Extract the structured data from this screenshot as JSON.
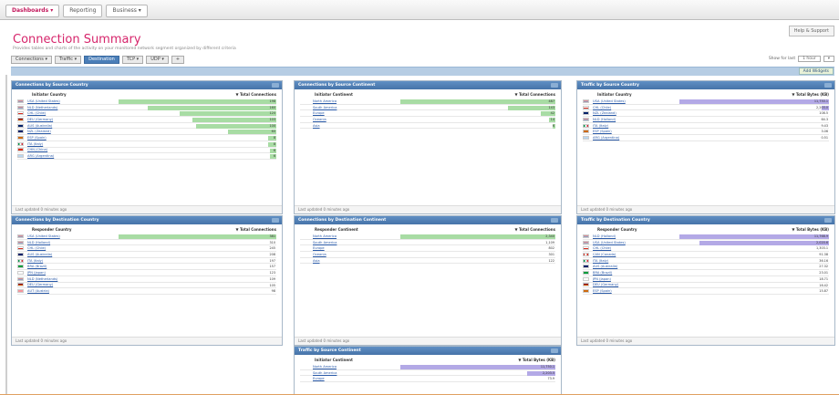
{
  "topnav": {
    "tabs": [
      "Dashboards ▾",
      "Reporting",
      "Business ▾"
    ]
  },
  "header": {
    "title": "Connection Summary",
    "subtitle": "Provides tables and charts of the activity on your monitored network segment organized by different criteria",
    "help_label": "Help & Support"
  },
  "filters": [
    "Connections ▾",
    "Traffic ▾",
    "Destination",
    "TCP ▾",
    "UDP ▾",
    "+"
  ],
  "showfor": {
    "label": "Show for last",
    "value": "1 hour",
    "unit": "▾"
  },
  "add_widget_label": "Add Widgets",
  "colors": {
    "accent": "#d6256b",
    "header_blue": "#4673a8",
    "bar_green": "#a8dca4",
    "bar_purple": "#b3a9e6"
  },
  "widgets": [
    {
      "title": "Connections by Source Country",
      "col_label": "Initiator Country",
      "col_value": "▼ Total Connections",
      "bar": "green",
      "footer": "Last updated 0 minutes ago",
      "rows": [
        {
          "label": "USA (United States)",
          "value": "198",
          "pct": 0.98,
          "flag": "us"
        },
        {
          "label": "NLD (Netherlands)",
          "value": "160",
          "pct": 0.8,
          "flag": "nl"
        },
        {
          "label": "CHL (Chile)",
          "value": "120",
          "pct": 0.6,
          "flag": "cl"
        },
        {
          "label": "DEU (Germany)",
          "value": "103",
          "pct": 0.52,
          "flag": "de"
        },
        {
          "label": "AUS (Australia)",
          "value": "100",
          "pct": 0.5,
          "flag": "au"
        },
        {
          "label": "NZL (Zealand)",
          "value": "60",
          "pct": 0.3,
          "flag": "nz"
        },
        {
          "label": "ESP (Spain)",
          "value": "8",
          "pct": 0.05,
          "flag": "es"
        },
        {
          "label": "ITA (Italy)",
          "value": "8",
          "pct": 0.05,
          "flag": "it"
        },
        {
          "label": "CHN (China)",
          "value": "6",
          "pct": 0.04,
          "flag": "cn"
        },
        {
          "label": "ARG (Argentina)",
          "value": "6",
          "pct": 0.04,
          "flag": "ar"
        }
      ]
    },
    {
      "title": "Connections by Source Continent",
      "col_label": "Initiator Continent",
      "col_value": "▼ Total Connections",
      "bar": "green",
      "footer": "Last updated 0 minutes ago",
      "rows": [
        {
          "label": "North America",
          "value": "487",
          "pct": 0.98
        },
        {
          "label": "South America",
          "value": "143",
          "pct": 0.3
        },
        {
          "label": "Europe",
          "value": "42",
          "pct": 0.09
        },
        {
          "label": "Oceania",
          "value": "14",
          "pct": 0.04
        },
        {
          "label": "Asia",
          "value": "6",
          "pct": 0.02
        }
      ]
    },
    {
      "title": "Traffic by Source Country",
      "col_label": "Initiator Country",
      "col_value": "▼ Total Bytes (KB)",
      "bar": "purple",
      "footer": "Last updated 0 minutes ago",
      "rows": [
        {
          "label": "USA (United States)",
          "value": "11,750.1",
          "pct": 0.98,
          "flag": "us"
        },
        {
          "label": "CHL (Chile)",
          "value": "2,203.0",
          "pct": 0.05,
          "flag": "cl"
        },
        {
          "label": "NZL (Zealand)",
          "value": "108.5",
          "pct": 0.0,
          "flag": "nz"
        },
        {
          "label": "NLD (Holland)",
          "value": "64.3",
          "pct": 0.0,
          "flag": "nl"
        },
        {
          "label": "ITA (Italy)",
          "value": "9.43",
          "pct": 0.0,
          "flag": "it"
        },
        {
          "label": "ESP (Spain)",
          "value": "3.06",
          "pct": 0.0,
          "flag": "es"
        },
        {
          "label": "ARG (Argentina)",
          "value": "0.51",
          "pct": 0.0,
          "flag": "ar"
        }
      ]
    },
    {
      "title": "Connections by Destination Country",
      "col_label": "Responder Country",
      "col_value": "▼ Total Connections",
      "bar": "green",
      "footer": "Last updated 0 minutes ago",
      "rows": [
        {
          "label": "USA (United States)",
          "value": "381",
          "pct": 0.98,
          "flag": "us"
        },
        {
          "label": "NLD (Holland)",
          "value": "310",
          "pct": 0.0,
          "flag": "nl"
        },
        {
          "label": "CHL (Chile)",
          "value": "245",
          "pct": 0.0,
          "flag": "cl"
        },
        {
          "label": "AUS (Australia)",
          "value": "208",
          "pct": 0.0,
          "flag": "au"
        },
        {
          "label": "ITA (Italy)",
          "value": "197",
          "pct": 0.0,
          "flag": "it"
        },
        {
          "label": "BRA (Brazil)",
          "value": "157",
          "pct": 0.0,
          "flag": "br"
        },
        {
          "label": "JPN (Japan)",
          "value": "123",
          "pct": 0.0,
          "flag": "jp"
        },
        {
          "label": "NLD (Netherlands)",
          "value": "109",
          "pct": 0.0,
          "flag": "nl"
        },
        {
          "label": "DEU (Germany)",
          "value": "105",
          "pct": 0.0,
          "flag": "de"
        },
        {
          "label": "AUT (Austria)",
          "value": "98",
          "pct": 0.0,
          "flag": "at"
        }
      ]
    },
    {
      "title": "Connections by Destination Continent",
      "col_label": "Responder Continent",
      "col_value": "▼ Total Connections",
      "bar": "green",
      "footer": "Last updated 0 minutes ago",
      "rows": [
        {
          "label": "North America",
          "value": "2,340",
          "pct": 0.98
        },
        {
          "label": "South America",
          "value": "1,109",
          "pct": 0.0
        },
        {
          "label": "Europe",
          "value": "802",
          "pct": 0.0
        },
        {
          "label": "Oceania",
          "value": "301",
          "pct": 0.0
        },
        {
          "label": "Asia",
          "value": "122",
          "pct": 0.0
        }
      ]
    },
    {
      "title": "Traffic by Destination Country",
      "col_label": "Responder Country",
      "col_value": "▼ Total Bytes (KB)",
      "bar": "purple",
      "footer": "Last updated 0 minutes ago",
      "rows": [
        {
          "label": "NLD (Holland)",
          "value": "11,768.9",
          "pct": 0.98,
          "flag": "nl"
        },
        {
          "label": "USA (United States)",
          "value": "2,020.6",
          "pct": 0.85,
          "flag": "us"
        },
        {
          "label": "CHL (Chile)",
          "value": "1,303.1",
          "pct": 0.0,
          "flag": "cl"
        },
        {
          "label": "CAN (Canada)",
          "value": "91.38",
          "pct": 0.0,
          "flag": "ca"
        },
        {
          "label": "ITA (Italy)",
          "value": "36.16",
          "pct": 0.0,
          "flag": "it"
        },
        {
          "label": "AUS (Australia)",
          "value": "27.32",
          "pct": 0.0,
          "flag": "au"
        },
        {
          "label": "BRA (Brazil)",
          "value": "23.01",
          "pct": 0.0,
          "flag": "br"
        },
        {
          "label": "JPN (Japan)",
          "value": "18.71",
          "pct": 0.0,
          "flag": "jp"
        },
        {
          "label": "DEU (Germany)",
          "value": "16.42",
          "pct": 0.0,
          "flag": "de"
        },
        {
          "label": "ESP (Spain)",
          "value": "15.87",
          "pct": 0.0,
          "flag": "es"
        }
      ]
    },
    {
      "title": "Traffic by Source Continent",
      "col_label": "Initiator Continent",
      "col_value": "▼ Total Bytes (KB)",
      "bar": "purple",
      "footer": "",
      "rows": [
        {
          "label": "North America",
          "value": "11,750.1",
          "pct": 0.98
        },
        {
          "label": "South America",
          "value": "2,203.5",
          "pct": 0.18
        },
        {
          "label": "Europe",
          "value": "73.9",
          "pct": 0.0
        }
      ]
    }
  ]
}
